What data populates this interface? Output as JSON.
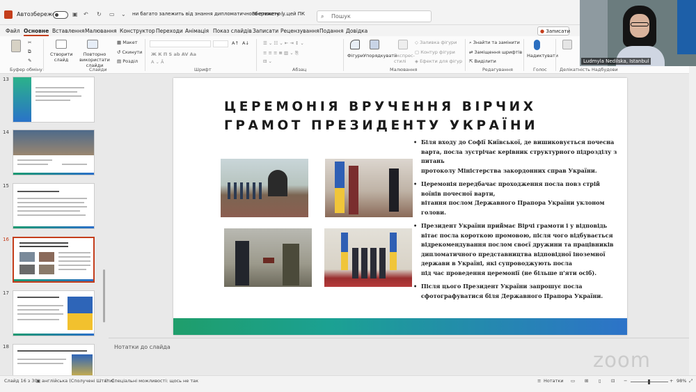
{
  "titlebar": {
    "autosave_label": "Автозбереження",
    "doc_title": "ни багато залежить від знання дипломатичного етикету (...",
    "save_status": "Збережено у цей ПК",
    "search_placeholder": "Пошук"
  },
  "menu": {
    "tabs": [
      "Файл",
      "Основне",
      "Вставлення",
      "Малювання",
      "Конструктор",
      "Переходи",
      "Анімація",
      "Показ слайдів",
      "Записати",
      "Рецензування",
      "Подання",
      "Довідка"
    ],
    "active": "Основне",
    "record_button": "Записати"
  },
  "ribbon": {
    "groups": {
      "clipboard": "Буфер обміну",
      "slides": "Слайди",
      "font": "Шрифт",
      "paragraph": "Абзац",
      "drawing": "Малювання",
      "editing": "Редагування",
      "voice": "Голос",
      "accessibility": "Делікатність",
      "addins": "Надбудови"
    },
    "buttons": {
      "new_slide": "Створити слайд",
      "reuse_slides": "Повторно використати слайди",
      "layout": "Макет",
      "reset": "Скинути",
      "section": "Розділ",
      "shapes": "Фігури",
      "arrange": "Упорядкувати",
      "quick_styles": "Експрес-стилі",
      "shape_fill": "Заливка фігури",
      "shape_outline": "Контур фігури",
      "shape_effects": "Ефекти для фігур",
      "find": "Знайти та замінити",
      "replace_fonts": "Заміщення шрифтів",
      "select": "Виділити",
      "dictate": "Надиктувати"
    }
  },
  "thumbnails": [
    {
      "number": "13",
      "selected": false
    },
    {
      "number": "14",
      "selected": false
    },
    {
      "number": "15",
      "selected": false
    },
    {
      "number": "16",
      "selected": true
    },
    {
      "number": "17",
      "selected": false
    },
    {
      "number": "18",
      "selected": false
    }
  ],
  "slide": {
    "title_line1": "ЦЕРЕМОНІЯ ВРУЧЕННЯ ВІРЧИХ",
    "title_line2": "ГРАМОТ ПРЕЗИДЕНТУ УКРАЇНИ",
    "bullets": [
      [
        "Біля входу до Софії Київської, де вишиковується почесна варта, посла зустрічає керівник структурного підрозділу з питань",
        "протоколу Міністерства закордонних справ України."
      ],
      [
        "Церемонія передбачає проходження посла повз стрій воїнів почесної варти,",
        "вітання послом Державного Прапора України уклоном голови."
      ],
      [
        "Президент України приймає Вірчі грамоти і у відповідь вітає посла короткою промовою, після чого відбувається відрекомендування послом своєї дружини та працівників дипломатичного представництва відповідної іноземної держави в Україні, які супроводжують посла",
        "під час проведення церемонії (не більше п'яти осіб)."
      ],
      [
        "Після цього Президент України запрошує посла сфотографуватися біля Державного Прапора України."
      ]
    ]
  },
  "notes_placeholder": "Нотатки до слайда",
  "statusbar": {
    "slide_counter": "Слайд 16 з 30",
    "language": "англійська (Сполучені Штати)",
    "accessibility": "Спеціальні можливості: щось не так",
    "notes_button": "Нотатки",
    "zoom_percent": "98%"
  },
  "webcam": {
    "participant": "Ludmyla Nedilska, Istanbul",
    "watermark": "zoom"
  },
  "colors": {
    "accent": "#c43e1c",
    "slide_bar_start": "#1f9e6b",
    "slide_bar_end": "#2d73c8"
  }
}
